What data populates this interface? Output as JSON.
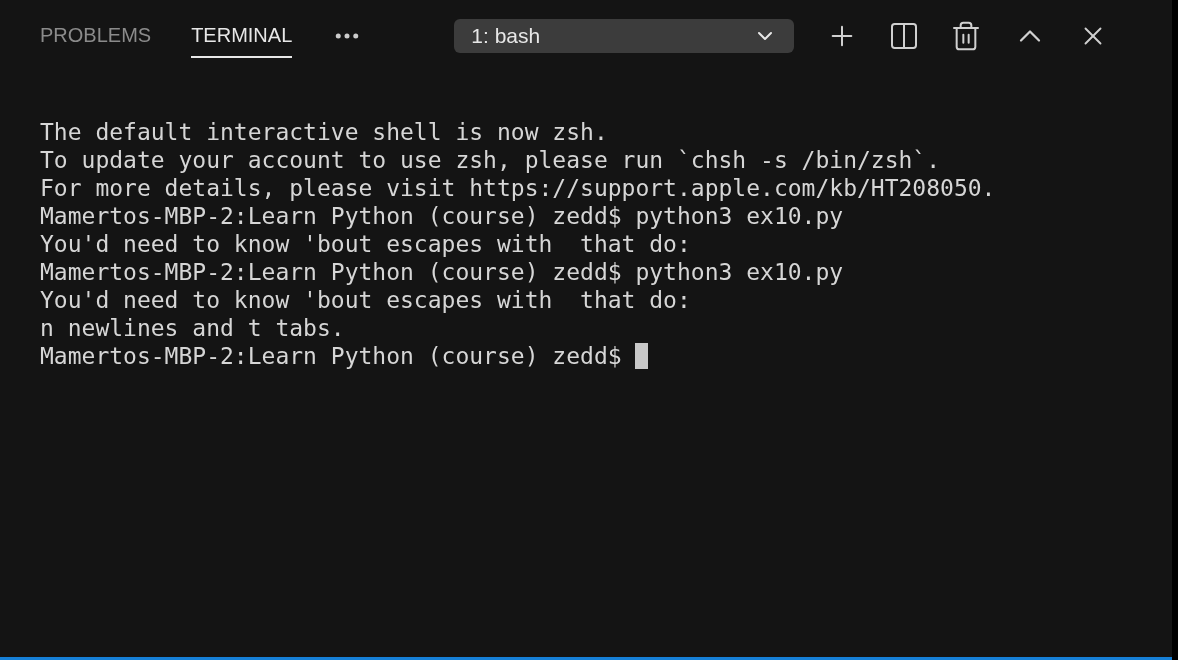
{
  "tabs": [
    {
      "label": "PROBLEMS",
      "selected": false
    },
    {
      "label": "TERMINAL",
      "selected": true
    }
  ],
  "terminal_select": {
    "value": "1: bash"
  },
  "terminal": {
    "lines": [
      "The default interactive shell is now zsh.",
      "To update your account to use zsh, please run `chsh -s /bin/zsh`.",
      "For more details, please visit https://support.apple.com/kb/HT208050.",
      "Mamertos-MBP-2:Learn Python (course) zedd$ python3 ex10.py",
      "You'd need to know 'bout escapes with  that do:",
      "Mamertos-MBP-2:Learn Python (course) zedd$ python3 ex10.py",
      "You'd need to know 'bout escapes with  that do:",
      "n newlines and t tabs."
    ],
    "prompt": "Mamertos-MBP-2:Learn Python (course) zedd$",
    "cursor_visible": true
  }
}
